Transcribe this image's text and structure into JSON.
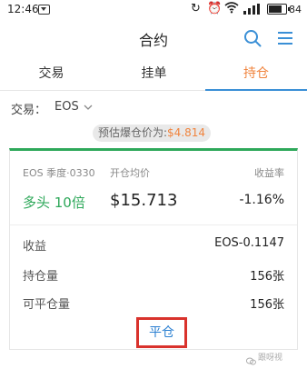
{
  "status_bar": {
    "time": "12:46",
    "battery": "84"
  },
  "header": {
    "title": "合约"
  },
  "tabs": [
    {
      "label": "交易",
      "active": false
    },
    {
      "label": "挂单",
      "active": false
    },
    {
      "label": "持仓",
      "active": true
    }
  ],
  "trade": {
    "label": "交易：",
    "value": "EOS"
  },
  "liquidation": {
    "label": "预估爆仓价为:",
    "price": "$4.814"
  },
  "position": {
    "contract": "EOS 季度·0330",
    "avg_price_label": "开仓均价",
    "yield_label": "收益率",
    "direction": "多头 10倍",
    "avg_price": "$15.713",
    "yield": "-1.16%",
    "rows": [
      {
        "label": "收益",
        "value": "EOS-0.1147"
      },
      {
        "label": "持仓量",
        "value": "156张"
      },
      {
        "label": "可平仓量",
        "value": "156张"
      }
    ],
    "close_button": "平仓"
  },
  "watermark": "跟呀视",
  "colors": {
    "accent_orange": "#f0843e",
    "long_green": "#2ea85a",
    "link_blue": "#2a7fd1",
    "tab_underline": "#3a8fd6",
    "highlight_red": "#d9322c"
  }
}
